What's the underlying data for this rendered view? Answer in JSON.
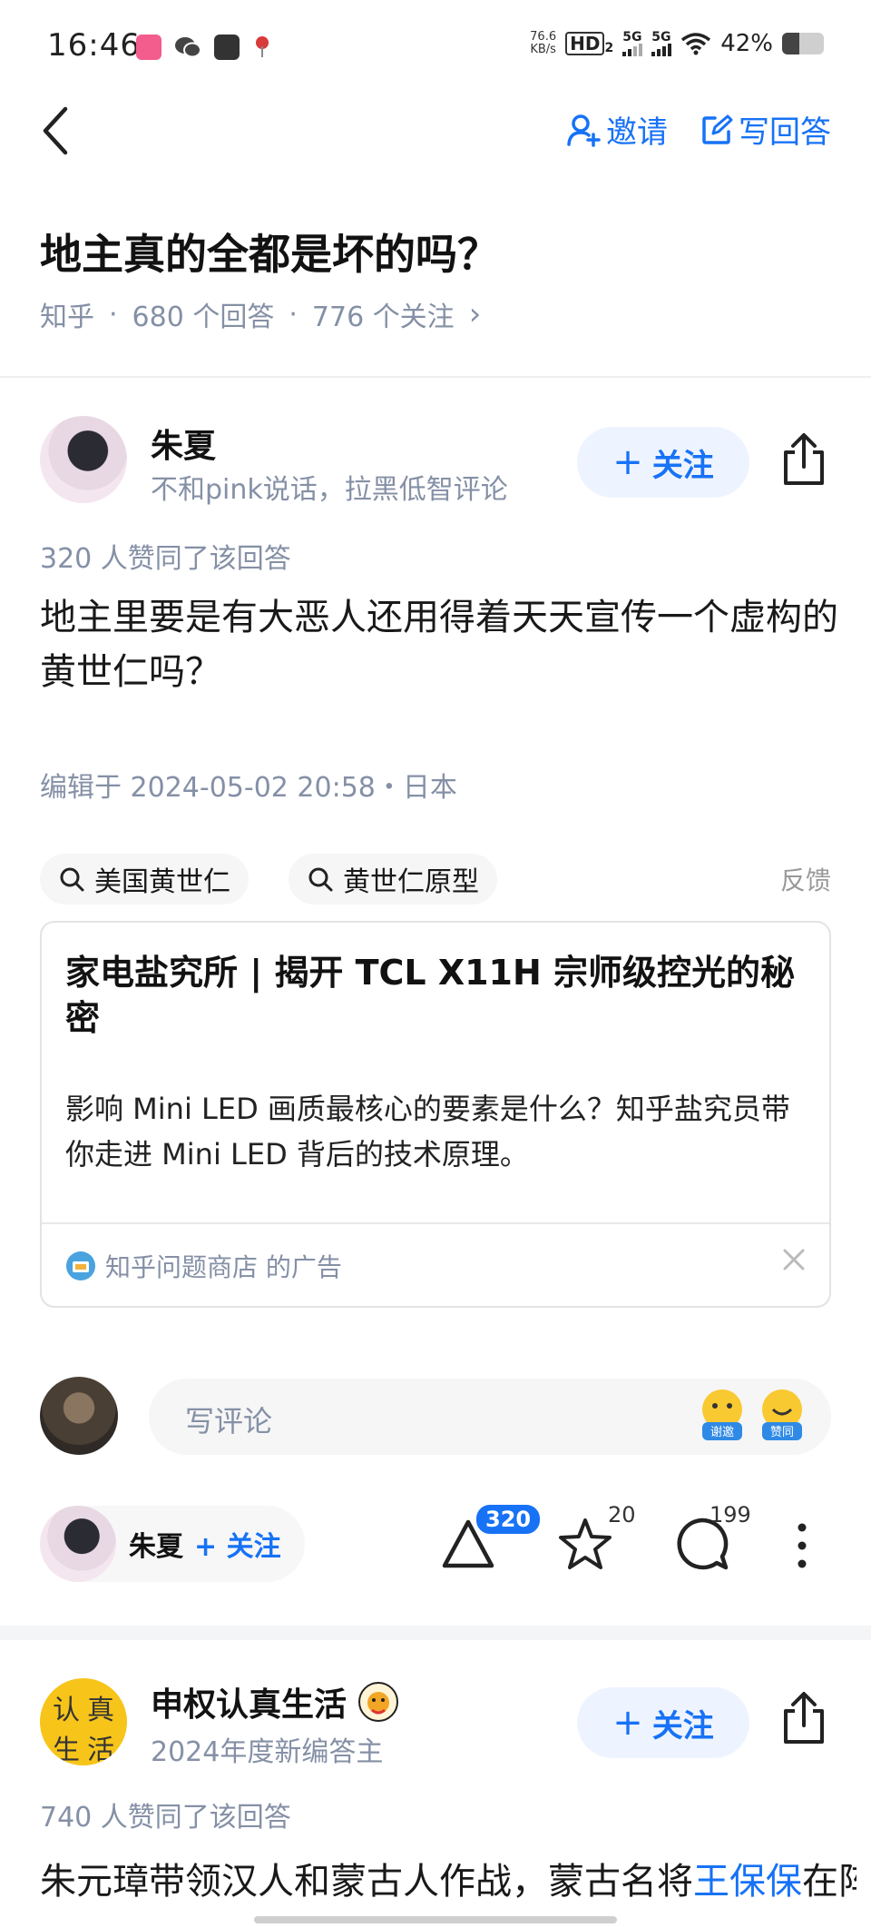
{
  "status_bar": {
    "time": "16:46",
    "net_speed_value": "76.6",
    "net_speed_unit": "KB/s",
    "hd_badge": "HD",
    "hd_sub": "2",
    "signal1_label": "5G",
    "signal2_label": "5G",
    "battery_percent": "42%",
    "battery_level": 0.42
  },
  "header": {
    "invite_label": "邀请",
    "write_answer_label": "写回答"
  },
  "question": {
    "title": "地主真的全都是坏的吗？",
    "source": "知乎",
    "answers_count": "680 个回答",
    "followers_count": "776 个关注",
    "chevron": "›"
  },
  "answer1": {
    "author": "朱夏",
    "bio": "不和pink说话，拉黑低智评论",
    "follow_label": "关注",
    "votes_line": "320 人赞同了该回答",
    "content": "地主里要是有大恶人还用得着天天宣传一个虚构的黄世仁吗？",
    "edited": "编辑于 2024-05-02 20:58・日本",
    "tags": [
      "美国黄世仁",
      "黄世仁原型"
    ],
    "feedback_label": "反馈"
  },
  "ad": {
    "title": "家电盐究所 | 揭开 TCL X11H 宗师级控光的秘密",
    "description": "影响 Mini LED 画质最核心的要素是什么？知乎盐究员带你走进 Mini LED 背后的技术原理。",
    "sponsor": "知乎问题商店 的广告"
  },
  "comment": {
    "placeholder": "写评论",
    "emoji1_label": "谢邀",
    "emoji2_label": "赞同"
  },
  "action_bar": {
    "author": "朱夏",
    "follow_label": "+ 关注",
    "vote_count": "320",
    "favorite_count": "20",
    "comment_count": "199"
  },
  "answer2": {
    "author": "申权认真生活",
    "bio": "2024年度新编答主",
    "follow_label": "关注",
    "votes_line": "740 人赞同了该回答",
    "content_start": "朱元璋带领汉人和蒙古人作战，蒙古名将",
    "content_link": "王保保",
    "content_rest": "在阵前向朱元璋喊话，说：“我们蒙",
    "avatar_chars": [
      "认",
      "真",
      "生",
      "活"
    ]
  },
  "colors": {
    "accent": "#1772f6",
    "muted": "#8590a6",
    "follow_bg": "#eef4ff"
  }
}
